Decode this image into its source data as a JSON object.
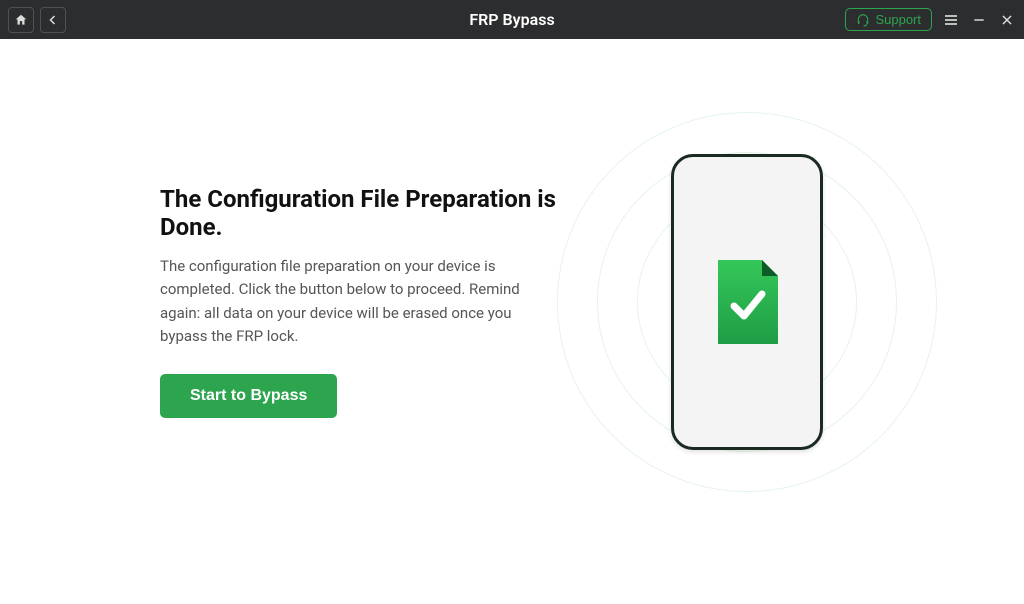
{
  "titlebar": {
    "title": "FRP Bypass",
    "support_label": "Support",
    "home_icon": "home-icon",
    "back_icon": "back-icon",
    "menu_icon": "hamburger-icon",
    "minimize_icon": "minimize-icon",
    "close_icon": "close-icon"
  },
  "main": {
    "heading": "The Configuration File Preparation is Done.",
    "description": "The configuration file preparation on your device is completed. Click the button below to proceed. Remind again: all data on your device will be erased once you bypass the FRP lock.",
    "primary_button_label": "Start to Bypass"
  },
  "illustration": {
    "phone_icon": "phone-outline",
    "doc_icon": "document-check-icon"
  },
  "colors": {
    "titlebar_bg": "#2b2d2e",
    "accent_green": "#2da44e",
    "dark_outline": "#1b2a21",
    "text_body": "#555555",
    "text_heading": "#111111"
  }
}
